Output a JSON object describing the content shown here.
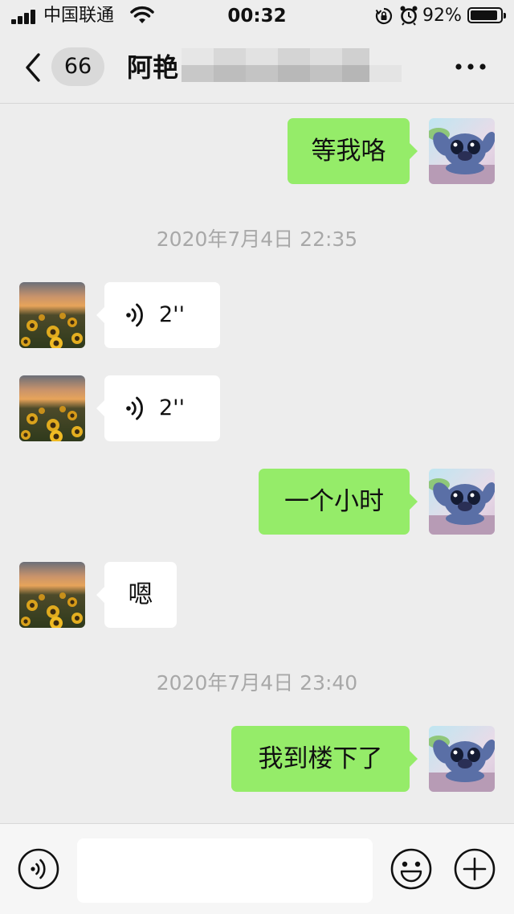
{
  "status_bar": {
    "carrier": "中国联通",
    "time": "00:32",
    "battery_percent": "92%",
    "battery_level": 0.92
  },
  "nav": {
    "unread_count": "66",
    "title": "阿艳"
  },
  "messages": [
    {
      "direction": "out",
      "type": "text",
      "text": "等我咯"
    },
    {
      "type": "timestamp",
      "text": "2020年7月4日 22:35"
    },
    {
      "direction": "in",
      "type": "voice",
      "duration": "2''"
    },
    {
      "direction": "in",
      "type": "voice",
      "duration": "2''"
    },
    {
      "direction": "out",
      "type": "text",
      "text": "一个小时"
    },
    {
      "direction": "in",
      "type": "text",
      "text": "嗯"
    },
    {
      "type": "timestamp",
      "text": "2020年7月4日 23:40"
    },
    {
      "direction": "out",
      "type": "text",
      "text": "我到楼下了"
    }
  ],
  "input_bar": {
    "value": "",
    "icons": [
      "voice-icon",
      "emoji-icon",
      "plus-icon"
    ]
  },
  "colors": {
    "outgoing_bubble": "#95ec69",
    "incoming_bubble": "#ffffff",
    "background": "#ededed"
  }
}
